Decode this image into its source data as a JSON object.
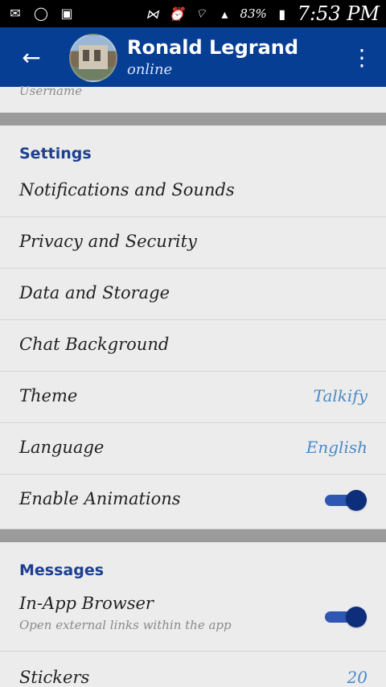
{
  "status_bar": {
    "left_icons": [
      "mail-icon",
      "whatsapp-icon",
      "gallery-icon"
    ],
    "right_icons": [
      "vibrate-icon",
      "alarm-icon",
      "wifi-icon",
      "signal-icon"
    ],
    "battery_text": "83%",
    "time": "7:53 PM"
  },
  "header": {
    "name": "Ronald Legrand",
    "status": "online"
  },
  "username_label": "Username",
  "settings": {
    "title": "Settings",
    "items": [
      {
        "label": "Notifications and Sounds"
      },
      {
        "label": "Privacy and Security"
      },
      {
        "label": "Data and Storage"
      },
      {
        "label": "Chat Background"
      },
      {
        "label": "Theme",
        "value": "Talkify"
      },
      {
        "label": "Language",
        "value": "English"
      },
      {
        "label": "Enable Animations",
        "toggle": true
      }
    ]
  },
  "messages": {
    "title": "Messages",
    "items": [
      {
        "label": "In-App Browser",
        "subtitle": "Open external links within the app",
        "toggle": true
      },
      {
        "label": "Stickers",
        "value": "20"
      }
    ]
  },
  "colors": {
    "app_bar": "#063e94",
    "accent": "#4a8ac7",
    "section_title": "#1d3f8f",
    "separator": "#9b9b9b",
    "background": "#ececec"
  }
}
